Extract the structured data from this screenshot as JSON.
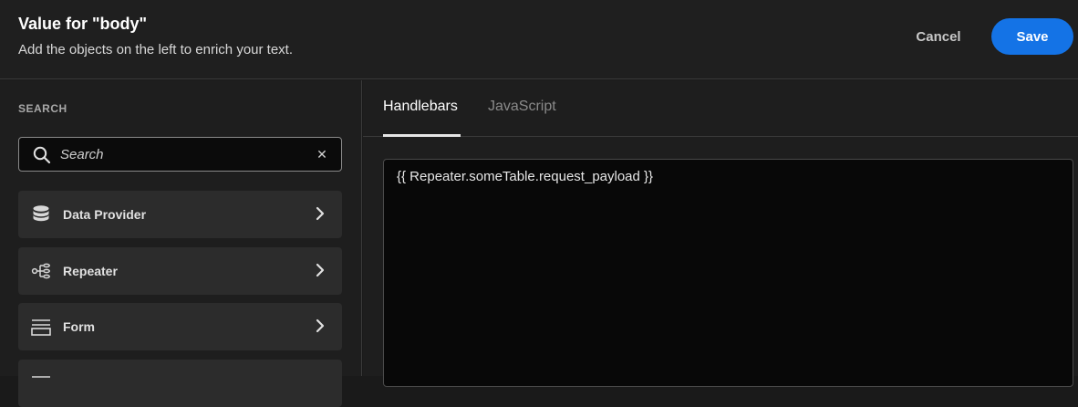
{
  "header": {
    "title": "Value for \"body\"",
    "subtitle": "Add the objects on the left to enrich your text.",
    "cancel_label": "Cancel",
    "save_label": "Save"
  },
  "sidebar": {
    "search_section_label": "SEARCH",
    "search": {
      "placeholder": "Search",
      "value": ""
    },
    "categories": [
      {
        "label": "Data Provider",
        "icon": "database-icon"
      },
      {
        "label": "Repeater",
        "icon": "repeater-icon"
      },
      {
        "label": "Form",
        "icon": "form-icon"
      }
    ]
  },
  "tabs": [
    {
      "label": "Handlebars",
      "active": true
    },
    {
      "label": "JavaScript",
      "active": false
    }
  ],
  "editor": {
    "value": "{{ Repeater.someTable.request_payload }}"
  },
  "colors": {
    "accent": "#1473e6",
    "background": "#1e1e1e",
    "editor_background": "#080808"
  }
}
